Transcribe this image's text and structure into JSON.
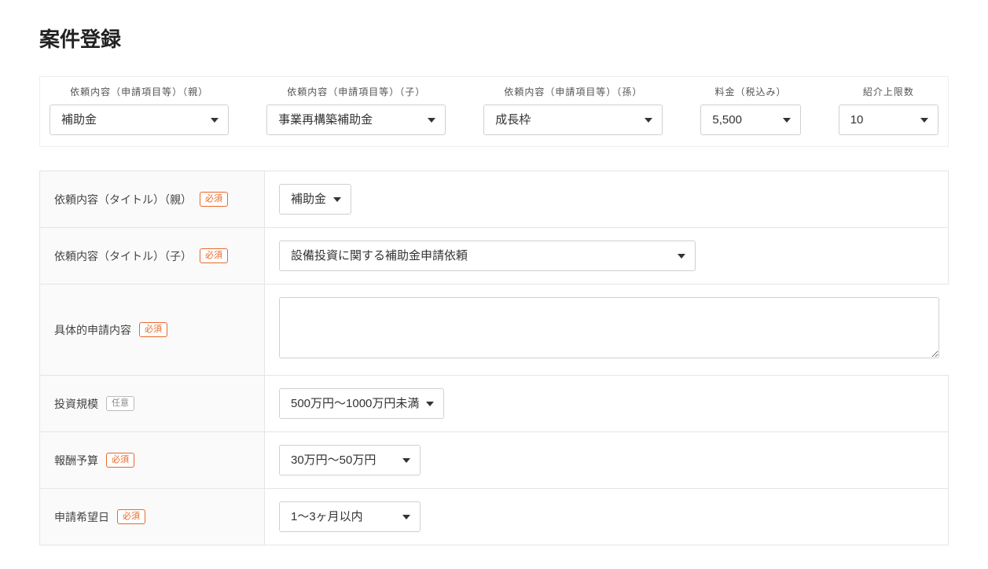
{
  "pageTitle": "案件登録",
  "filters": {
    "parent": {
      "label": "依頼内容（申請項目等）（親）",
      "value": "補助金"
    },
    "child": {
      "label": "依頼内容（申請項目等）（子）",
      "value": "事業再構築補助金"
    },
    "grandchild": {
      "label": "依頼内容（申請項目等）（孫）",
      "value": "成長枠"
    },
    "fee": {
      "label": "料金（税込み）",
      "value": "5,500"
    },
    "limit": {
      "label": "紹介上限数",
      "value": "10"
    }
  },
  "badges": {
    "required": "必須",
    "optional": "任意"
  },
  "form": {
    "titleParent": {
      "label": "依頼内容（タイトル）（親）",
      "value": "補助金"
    },
    "titleChild": {
      "label": "依頼内容（タイトル）（子）",
      "value": "設備投資に関する補助金申請依頼"
    },
    "details": {
      "label": "具体的申請内容",
      "value": ""
    },
    "investment": {
      "label": "投資規模",
      "value": "500万円〜1000万円未満"
    },
    "budget": {
      "label": "報酬予算",
      "value": "30万円〜50万円"
    },
    "desiredDate": {
      "label": "申請希望日",
      "value": "1〜3ヶ月以内"
    }
  }
}
